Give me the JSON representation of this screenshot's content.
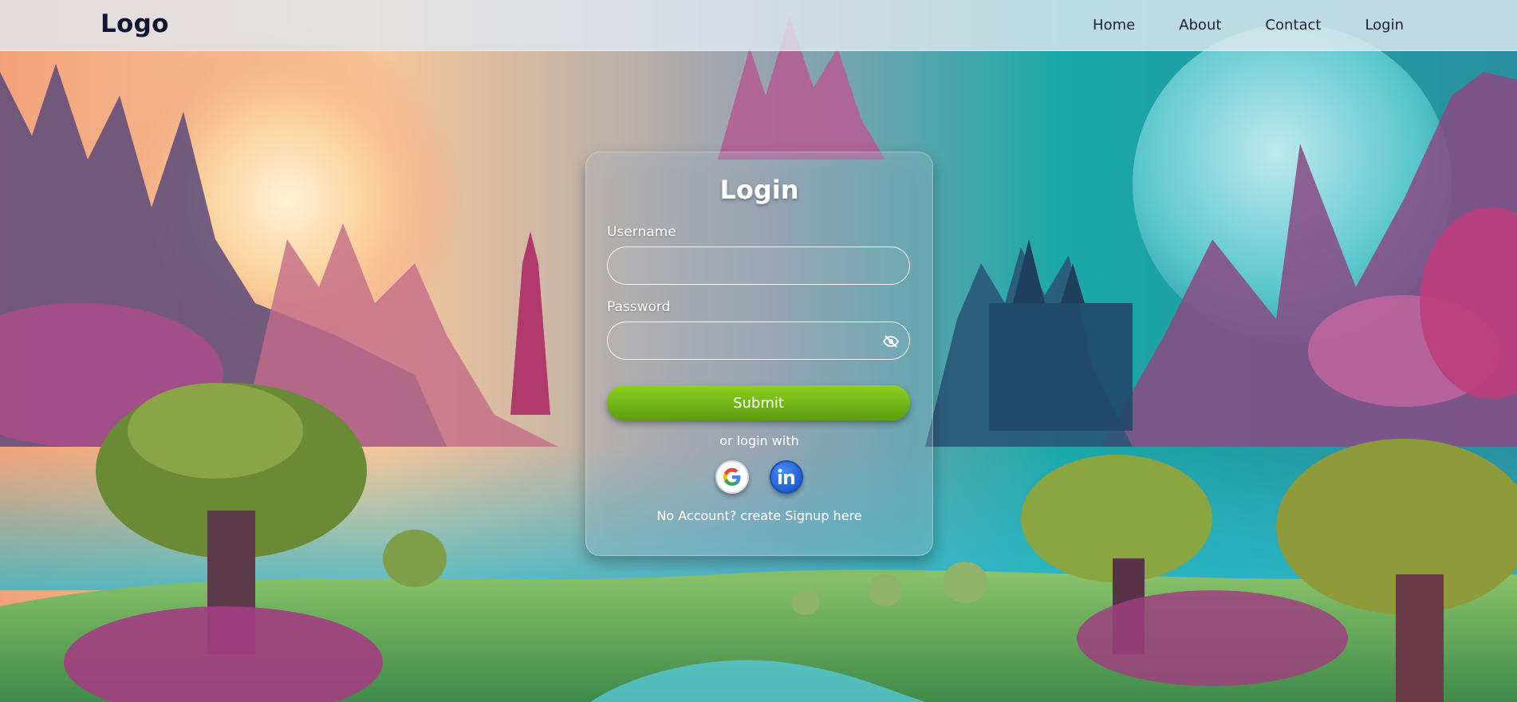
{
  "navbar": {
    "logo": "Logo",
    "links": [
      "Home",
      "About",
      "Contact",
      "Login"
    ]
  },
  "login_card": {
    "title": "Login",
    "username": {
      "label": "Username",
      "value": ""
    },
    "password": {
      "label": "Password",
      "value": ""
    },
    "submit_label": "Submit",
    "alt_login_text": "or login with",
    "social_icons": [
      "google-icon",
      "linkedin-icon"
    ],
    "signup_text": "No Account? create Signup here"
  },
  "colors": {
    "navbar_bg": "#e1e8f0",
    "logo_text": "#0f1530",
    "submit_green": "#7cc21a",
    "linkedin_blue": "#1f5fd4"
  }
}
